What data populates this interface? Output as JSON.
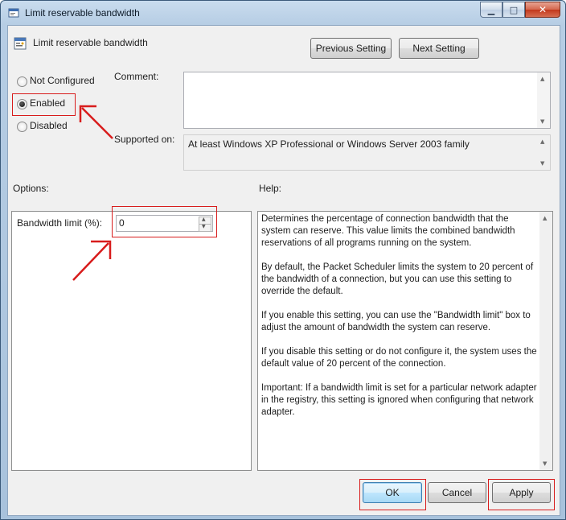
{
  "window": {
    "title": "Limit reservable bandwidth",
    "title_icon": "policy-icon"
  },
  "header": {
    "setting_name": "Limit reservable bandwidth",
    "previous_button": "Previous Setting",
    "next_button": "Next Setting"
  },
  "state": {
    "not_configured_label": "Not Configured",
    "enabled_label": "Enabled",
    "disabled_label": "Disabled",
    "selected": "Enabled"
  },
  "comment": {
    "label": "Comment:",
    "value": ""
  },
  "supported": {
    "label": "Supported on:",
    "value": "At least Windows XP Professional or Windows Server 2003 family"
  },
  "options": {
    "label": "Options:",
    "bandwidth_label": "Bandwidth limit (%):",
    "bandwidth_value": "0"
  },
  "help": {
    "label": "Help:",
    "paragraphs": [
      "Determines the percentage of connection bandwidth that the system can reserve. This value limits the combined bandwidth reservations of all programs running on the system.",
      "By default, the Packet Scheduler limits the system to 20 percent of the bandwidth of a connection, but you can use this setting to override the default.",
      "If you enable this setting, you can use the \"Bandwidth limit\" box to adjust the amount of bandwidth the system can reserve.",
      "If you disable this setting or do not configure it, the system uses the default value of 20 percent of the connection.",
      "Important: If a bandwidth limit is set for a particular network adapter in the registry, this setting is ignored when configuring that network adapter."
    ]
  },
  "footer": {
    "ok": "OK",
    "cancel": "Cancel",
    "apply": "Apply"
  },
  "colors": {
    "annotation_red": "#d81c1c",
    "dialog_background": "#f0f0f0",
    "titlebar_blue": "#b6cde4"
  }
}
